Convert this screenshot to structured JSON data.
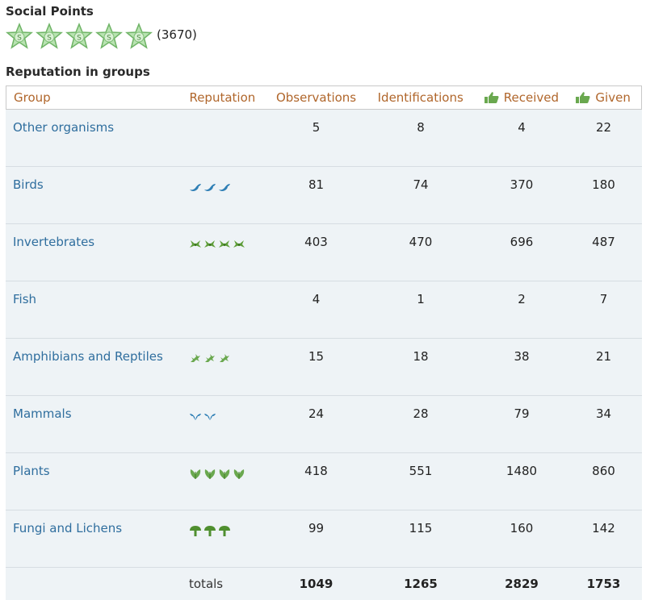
{
  "social": {
    "title": "Social Points",
    "star_count": 5,
    "star_letter": "S",
    "points": "(3670)",
    "star_color": "#b9e3b2"
  },
  "reputation": {
    "title": "Reputation in groups",
    "columns": {
      "group": "Group",
      "reputation": "Reputation",
      "observations": "Observations",
      "identifications": "Identifications",
      "received": "Received",
      "given": "Given"
    },
    "rows": [
      {
        "group": "Other organisms",
        "rep_icon": "none",
        "rep_count": 0,
        "observations": "5",
        "identifications": "8",
        "received": "4",
        "given": "22"
      },
      {
        "group": "Birds",
        "rep_icon": "bird-icon",
        "rep_count": 3,
        "observations": "81",
        "identifications": "74",
        "received": "370",
        "given": "180"
      },
      {
        "group": "Invertebrates",
        "rep_icon": "insect-icon",
        "rep_count": 4,
        "observations": "403",
        "identifications": "470",
        "received": "696",
        "given": "487"
      },
      {
        "group": "Fish",
        "rep_icon": "none",
        "rep_count": 0,
        "observations": "4",
        "identifications": "1",
        "received": "2",
        "given": "7"
      },
      {
        "group": "Amphibians and Reptiles",
        "rep_icon": "lizard-icon",
        "rep_count": 3,
        "observations": "15",
        "identifications": "18",
        "received": "38",
        "given": "21"
      },
      {
        "group": "Mammals",
        "rep_icon": "bat-icon",
        "rep_count": 2,
        "observations": "24",
        "identifications": "28",
        "received": "79",
        "given": "34"
      },
      {
        "group": "Plants",
        "rep_icon": "leaf-icon",
        "rep_count": 4,
        "observations": "418",
        "identifications": "551",
        "received": "1480",
        "given": "860"
      },
      {
        "group": "Fungi and Lichens",
        "rep_icon": "mushroom-icon",
        "rep_count": 3,
        "observations": "99",
        "identifications": "115",
        "received": "160",
        "given": "142"
      }
    ],
    "totals": {
      "label": "totals",
      "observations": "1049",
      "identifications": "1265",
      "received": "2829",
      "given": "1753"
    }
  },
  "colors": {
    "header_text": "#b0662b",
    "link": "#2f6e9e",
    "row_bg": "#eef3f6",
    "thumb_green": "#6aa84f",
    "bird_blue": "#2f7fb5",
    "insect_green": "#5f9e3a"
  }
}
